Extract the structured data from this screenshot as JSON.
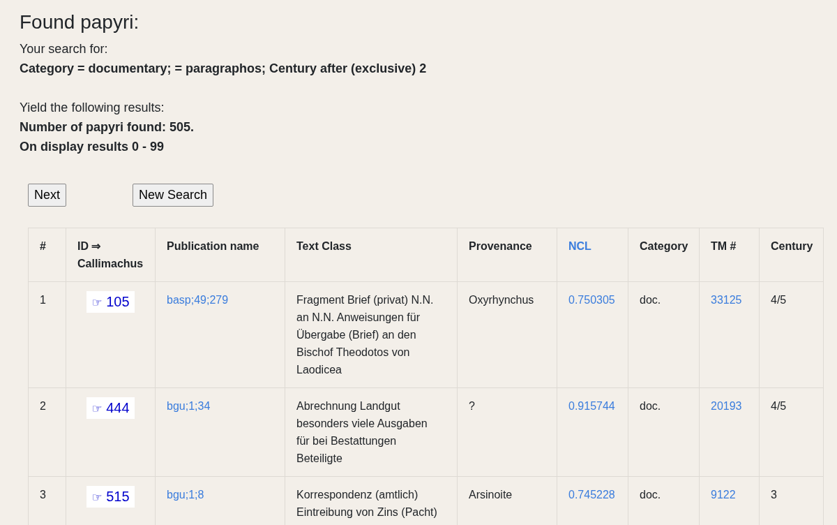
{
  "title": "Found papyri:",
  "search": {
    "label": "Your search for:",
    "query": "Category = documentary; = paragraphos; Century after (exclusive) 2"
  },
  "results": {
    "label": "Yield the following results:",
    "count": "Number of papyri found: 505.",
    "range": "On display results 0 - 99"
  },
  "buttons": [
    {
      "kind": "next",
      "label": "Next"
    },
    {
      "kind": "new_search",
      "label": "New Search"
    }
  ],
  "table": {
    "columns": [
      {
        "label": "#",
        "kind": "text"
      },
      {
        "label": "ID ⇒ Callimachus",
        "kind": "text"
      },
      {
        "label": "Publication name",
        "kind": "text"
      },
      {
        "label": "Text Class",
        "kind": "text"
      },
      {
        "label": "Provenance",
        "kind": "text"
      },
      {
        "label": "NCL",
        "kind": "link"
      },
      {
        "label": "Category",
        "kind": "text"
      },
      {
        "label": "TM #",
        "kind": "text"
      },
      {
        "label": "Century",
        "kind": "text"
      }
    ],
    "rows": [
      {
        "number": "1",
        "id_marker": "☞",
        "id": "105",
        "publication": "basp;49;279",
        "text_class": "Fragment Brief (privat) N.N. an N.N. Anweisungen für Übergabe (Brief) an den Bischof Theodotos von Laodicea",
        "provenance": "Oxyrhynchus",
        "ncl": "0.750305",
        "category": "doc.",
        "tm": "33125",
        "century": "4/5"
      },
      {
        "number": "2",
        "id_marker": "☞",
        "id": "444",
        "publication": "bgu;1;34",
        "text_class": "Abrechnung Landgut besonders viele Ausgaben für bei Bestattungen Beteiligte",
        "provenance": "?",
        "ncl": "0.915744",
        "category": "doc.",
        "tm": "20193",
        "century": "4/5"
      },
      {
        "number": "3",
        "id_marker": "☞",
        "id": "515",
        "publication": "bgu;1;8",
        "text_class": "Korrespondenz (amtlich) Eintreibung von Zins (Pacht)",
        "provenance": "Arsinoite",
        "ncl": "0.745228",
        "category": "doc.",
        "tm": "9122",
        "century": "3"
      }
    ]
  }
}
